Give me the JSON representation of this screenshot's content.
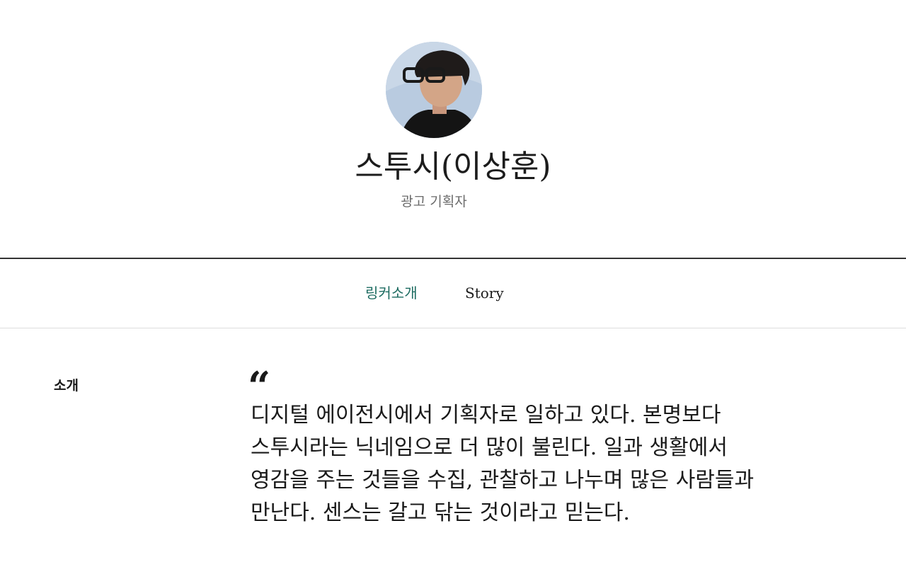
{
  "profile": {
    "name": "스투시(이상훈)",
    "role": "광고 기획자"
  },
  "tabs": [
    {
      "label": "링커소개",
      "active": true
    },
    {
      "label": "Story",
      "active": false
    }
  ],
  "intro": {
    "section_label": "소개",
    "quote_mark": "“",
    "lines": [
      "디지털 에이전시에서 기획자로 일하고 있다. 본명보다",
      "스투시라는 닉네임으로 더 많이 불린다. 일과 생활에서",
      "영감을 주는 것들을 수집, 관찰하고 나누며 많은 사람들과",
      "만난다. 센스는 갈고 닦는 것이라고 믿는다."
    ]
  },
  "colors": {
    "active_tab": "#1c6b60",
    "text": "#1a1a1a",
    "muted": "#6b6b6b",
    "avatar_background": "#b9cbe0"
  }
}
